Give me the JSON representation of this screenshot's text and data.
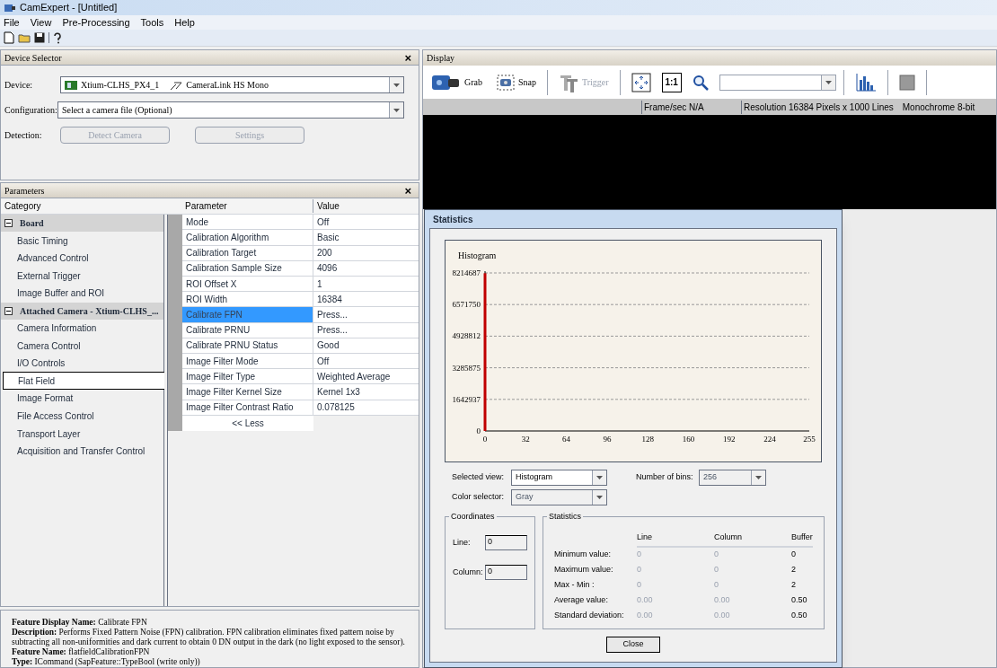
{
  "window": {
    "title": "CamExpert - [Untitled]"
  },
  "menu": [
    "File",
    "View",
    "Pre-Processing",
    "Tools",
    "Help"
  ],
  "device_selector": {
    "title": "Device Selector",
    "close": "×",
    "device_label": "Device:",
    "device": "Xtium-CLHS_PX4_1",
    "camera": "CameraLink HS Mono",
    "configuration_label": "Configuration:",
    "configuration": "Select a camera file (Optional)",
    "detection_label": "Detection:",
    "buttons": [
      {
        "label": "Detect Camera",
        "disabled": true
      },
      {
        "label": "Settings",
        "disabled": true
      }
    ]
  },
  "parameters": {
    "title": "Parameters",
    "close": "×",
    "category_header": "Category",
    "parameter_header": "Parameter",
    "value_header": "Value",
    "categories": [
      {
        "label": "Board",
        "expanded": true,
        "selected": false,
        "children": [
          {
            "label": "Basic Timing",
            "selected": false
          },
          {
            "label": "Advanced Control",
            "selected": false
          },
          {
            "label": "External Trigger",
            "selected": false
          },
          {
            "label": "Image Buffer and ROI",
            "selected": false
          }
        ]
      },
      {
        "label": "Attached Camera - Xtium-CLHS_...",
        "expanded": true,
        "selected": false,
        "children": [
          {
            "label": "Camera Information",
            "selected": false
          },
          {
            "label": "Camera Control",
            "selected": false
          },
          {
            "label": "I/O Controls",
            "selected": false
          },
          {
            "label": "Flat Field",
            "selected": true
          },
          {
            "label": "Image Format",
            "selected": false
          },
          {
            "label": "File Access Control",
            "selected": false
          },
          {
            "label": "Transport Layer",
            "selected": false
          },
          {
            "label": "Acquisition and Transfer Control",
            "selected": false
          }
        ]
      }
    ],
    "rows": [
      {
        "parameter": "Mode",
        "value": "Off",
        "selected": false
      },
      {
        "parameter": "Calibration Algorithm",
        "value": "Basic",
        "selected": false
      },
      {
        "parameter": "Calibration Target",
        "value": "200",
        "selected": false
      },
      {
        "parameter": "Calibration Sample Size",
        "value": "4096",
        "selected": false
      },
      {
        "parameter": "ROI Offset X",
        "value": "1",
        "selected": false
      },
      {
        "parameter": "ROI Width",
        "value": "16384",
        "selected": false
      },
      {
        "parameter": "Calibrate FPN",
        "value": "Press...",
        "selected": true
      },
      {
        "parameter": "Calibrate PRNU",
        "value": "Press...",
        "selected": false
      },
      {
        "parameter": "Calibrate PRNU Status",
        "value": "Good",
        "selected": false
      },
      {
        "parameter": "Image Filter Mode",
        "value": "Off",
        "selected": false
      },
      {
        "parameter": "Image Filter Type",
        "value": "Weighted Average",
        "selected": false
      },
      {
        "parameter": "Image Filter Kernel Size",
        "value": "Kernel 1x3",
        "selected": false
      },
      {
        "parameter": "Image Filter Contrast Ratio",
        "value": "0.078125",
        "selected": false
      }
    ],
    "less": "<< Less"
  },
  "description": [
    "**Feature Display Name:** Calibrate FPN",
    "**Description:** Performs Fixed Pattern Noise (FPN) calibration. FPN calibration eliminates fixed pattern noise by subtracting all non-uniformities and dark current to obtain 0 DN output in the dark (no light exposed to the sensor).",
    "**Feature Name:** flatfieldCalibrationFPN",
    "**Type:** ICommand (SapFeature::TypeBool (write only))"
  ],
  "display": {
    "title": "Display",
    "toolbar": [
      {
        "kind": "camera",
        "label": "Grab",
        "disabled": false
      },
      {
        "kind": "snap",
        "label": "Snap",
        "disabled": false
      },
      {
        "kind": "trigger",
        "label": "Trigger",
        "disabled": true
      },
      {
        "kind": "fit"
      },
      {
        "kind": "text",
        "label": "1:1"
      },
      {
        "kind": "zoom"
      },
      {
        "kind": "combo"
      },
      {
        "kind": "histogram"
      },
      {
        "kind": "stop"
      }
    ],
    "status": [
      "Frame/sec N/A",
      "Resolution 16384 Pixels x 1000 Lines",
      "Monochrome 8-bit"
    ]
  },
  "statistics": {
    "title": "Statistics",
    "chart_data": {
      "type": "bar",
      "title": "Histogram",
      "grid": true,
      "x": [
        0
      ],
      "values": [
        8200000
      ],
      "xlim": [
        0,
        255
      ],
      "ylim": [
        0,
        8214687
      ],
      "xticks": [
        0,
        32,
        64,
        96,
        128,
        160,
        192,
        224,
        255
      ],
      "yticks": [
        0,
        1642937,
        3285875,
        4928812,
        6571750,
        8214687
      ]
    },
    "selected_view_label": "Selected view:",
    "selected_view": "Histogram",
    "bins_label": "Number of bins:",
    "bins": "256",
    "color_label": "Color selector:",
    "color_selection": "Gray",
    "coordinates": {
      "title": "Coordinates",
      "line_label": "Line:",
      "line": "0",
      "column_label": "Column:",
      "column": "0"
    },
    "stats": {
      "title": "Statistics",
      "columns": [
        "Line",
        "Column",
        "Buffer"
      ],
      "rows": [
        {
          "label": "Minimum value:",
          "values": [
            "0",
            "0",
            "0"
          ]
        },
        {
          "label": "Maximum value:",
          "values": [
            "0",
            "0",
            "2"
          ]
        },
        {
          "label": "Max - Min :",
          "values": [
            "0",
            "0",
            "2"
          ]
        },
        {
          "label": "Average value:",
          "values": [
            "0.00",
            "0.00",
            "0.50"
          ]
        },
        {
          "label": "Standard deviation:",
          "values": [
            "0.00",
            "0.00",
            "0.50"
          ]
        }
      ]
    },
    "close": "Close"
  }
}
